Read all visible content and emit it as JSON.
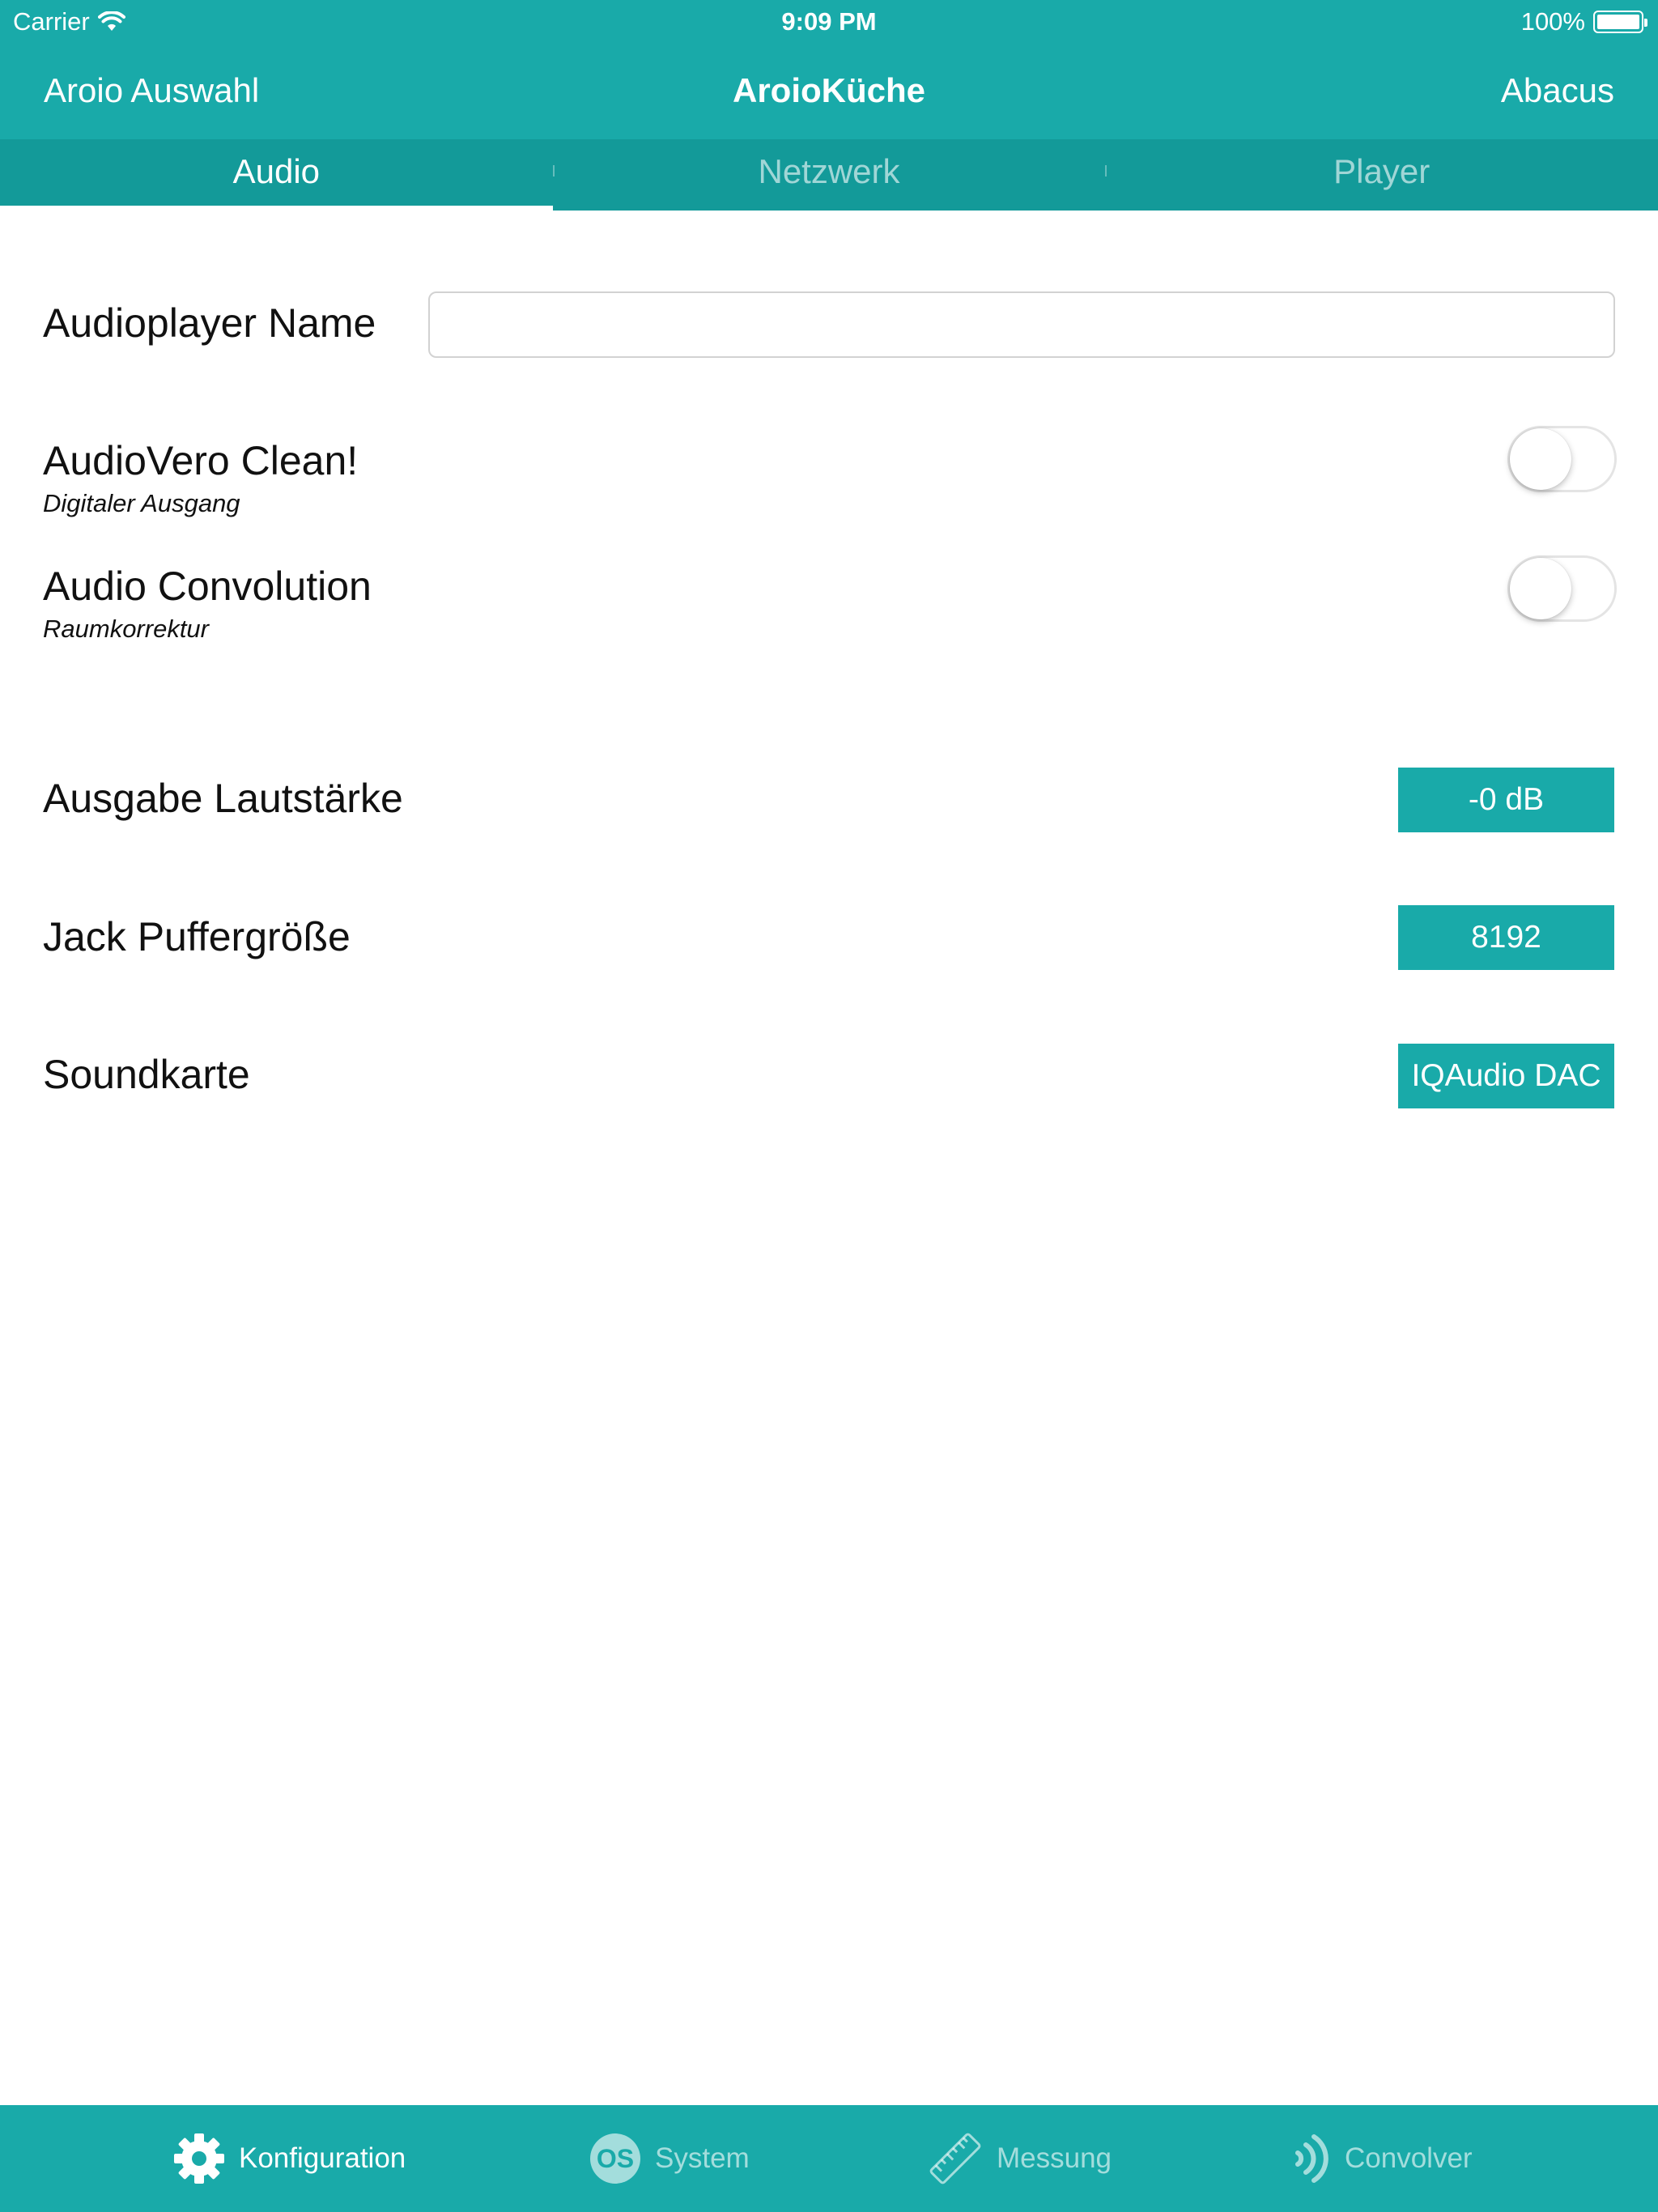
{
  "status_bar": {
    "carrier": "Carrier",
    "time": "9:09 PM",
    "battery": "100%"
  },
  "nav": {
    "left": "Aroio Auswahl",
    "title": "AroioKüche",
    "right": "Abacus"
  },
  "tabs": [
    {
      "label": "Audio",
      "active": true
    },
    {
      "label": "Netzwerk",
      "active": false
    },
    {
      "label": "Player",
      "active": false
    }
  ],
  "form": {
    "player_name": {
      "label": "Audioplayer Name",
      "value": "",
      "placeholder": ""
    },
    "audiovero": {
      "label": "AudioVero Clean!",
      "sublabel": "Digitaler Ausgang",
      "on": false
    },
    "convolution": {
      "label": "Audio Convolution",
      "sublabel": "Raumkorrektur",
      "on": false
    },
    "volume": {
      "label": "Ausgabe Lautstärke",
      "value": "-0 dB"
    },
    "buffer": {
      "label": "Jack Puffergröße",
      "value": "8192"
    },
    "soundcard": {
      "label": "Soundkarte",
      "value": "IQAudio DAC"
    }
  },
  "tabbar": [
    {
      "label": "Konfiguration",
      "icon": "gear-icon",
      "active": true
    },
    {
      "label": "System",
      "icon": "os-icon",
      "active": false
    },
    {
      "label": "Messung",
      "icon": "ruler-icon",
      "active": false
    },
    {
      "label": "Convolver",
      "icon": "sound-waves-icon",
      "active": false
    }
  ],
  "colors": {
    "accent": "#19aaa9",
    "accent_dark": "#139a99"
  }
}
